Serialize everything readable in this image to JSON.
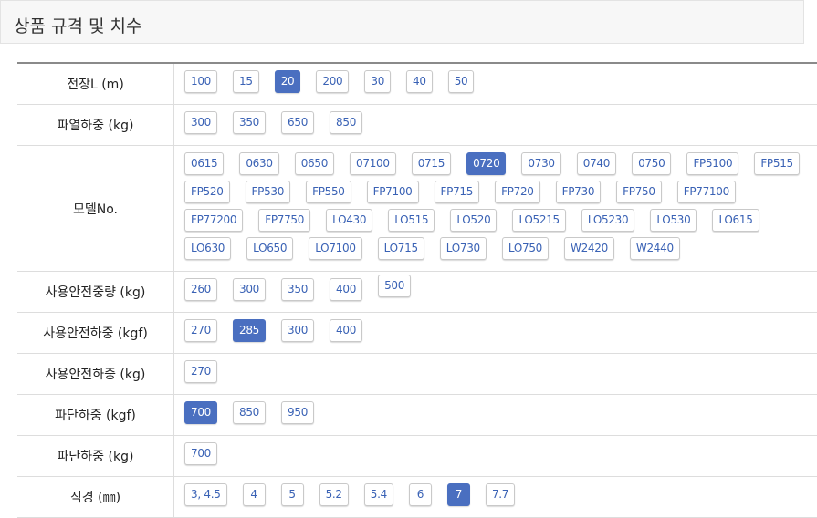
{
  "header": {
    "title": "상품 규격 및 치수"
  },
  "rows": [
    {
      "label": "전장L (m)",
      "options": [
        "100",
        "15",
        "20",
        "200",
        "30",
        "40",
        "50"
      ],
      "selected": "20"
    },
    {
      "label": "파열하중 (kg)",
      "options": [
        "300",
        "350",
        "650",
        "850"
      ],
      "selected": null
    },
    {
      "label": "모델No.",
      "options": [
        "0615",
        "0630",
        "0650",
        "07100",
        "0715",
        "0720",
        "0730",
        "0740",
        "0750",
        "FP5100",
        "FP515",
        "FP520",
        "FP530",
        "FP550",
        "FP7100",
        "FP715",
        "FP720",
        "FP730",
        "FP750",
        "FP77100",
        "FP77200",
        "FP7750",
        "LO430",
        "LO515",
        "LO520",
        "LO5215",
        "LO5230",
        "LO530",
        "LO615",
        "LO630",
        "LO650",
        "LO7100",
        "LO715",
        "LO730",
        "LO750",
        "W2420",
        "W2440"
      ],
      "selected": "0720"
    },
    {
      "label": "사용안전중량 (kg)",
      "options": [
        "260",
        "300",
        "350",
        "400",
        "500"
      ],
      "selected": null
    },
    {
      "label": "사용안전하중 (kgf)",
      "options": [
        "270",
        "285",
        "300",
        "400"
      ],
      "selected": "285"
    },
    {
      "label": "사용안전하중 (kg)",
      "options": [
        "270"
      ],
      "selected": null
    },
    {
      "label": "파단하중 (kgf)",
      "options": [
        "700",
        "850",
        "950"
      ],
      "selected": "700"
    },
    {
      "label": "파단하중 (kg)",
      "options": [
        "700"
      ],
      "selected": null
    },
    {
      "label": "직경 (㎜)",
      "options": [
        "3, 4.5",
        "4",
        "5",
        "5.2",
        "5.4",
        "6",
        "7",
        "7.7"
      ],
      "selected": "7"
    }
  ]
}
